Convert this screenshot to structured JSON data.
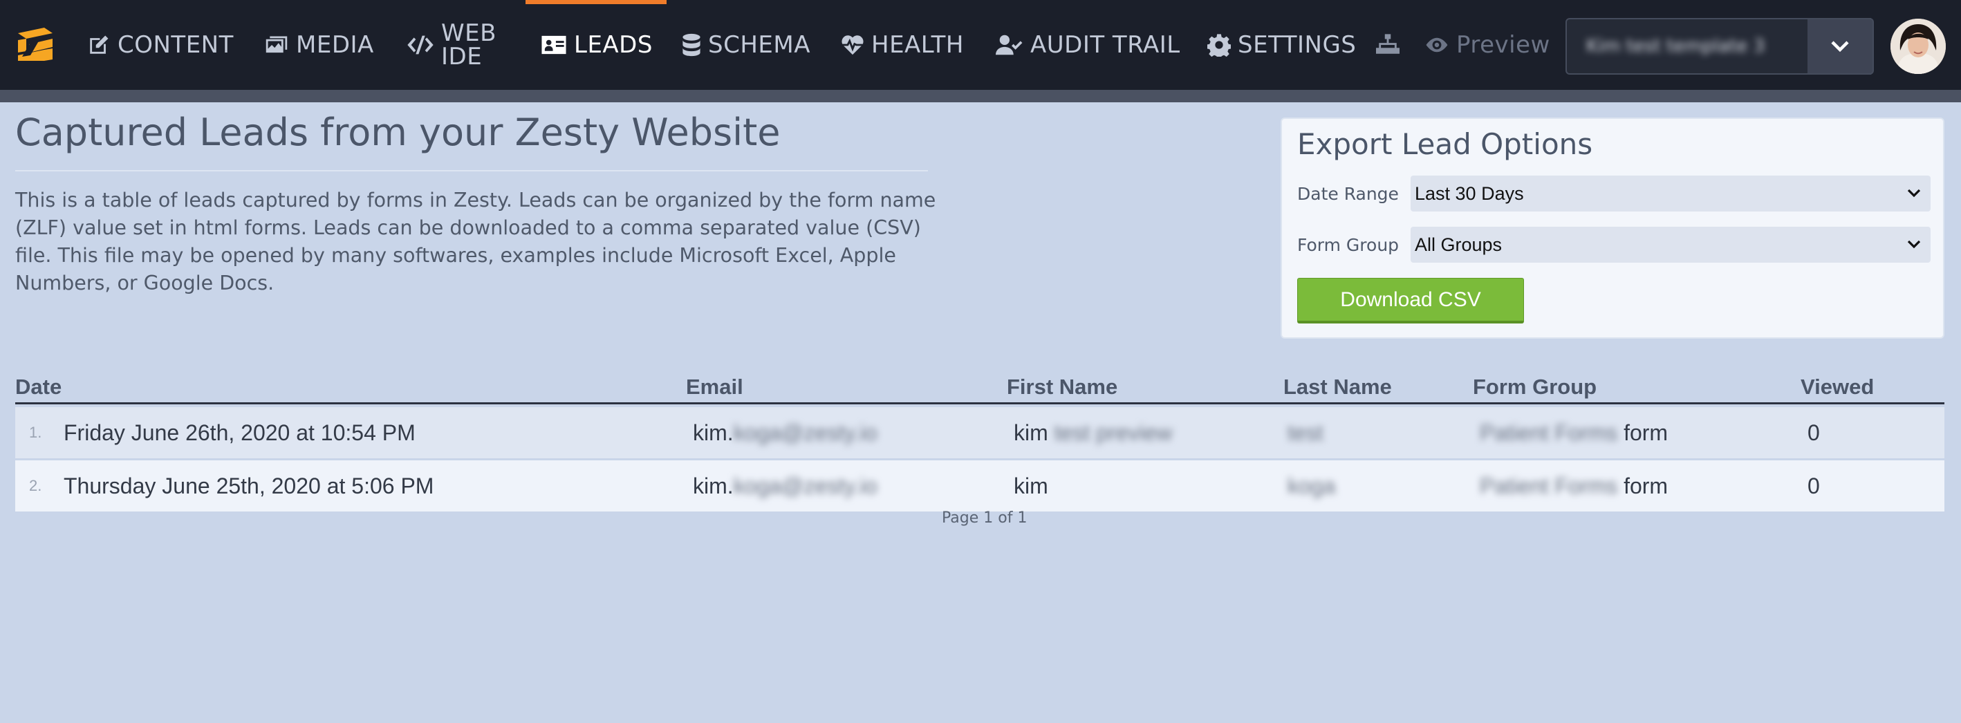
{
  "nav": {
    "items": [
      {
        "label": "CONTENT",
        "icon": "edit-icon"
      },
      {
        "label": "MEDIA",
        "icon": "images-icon"
      },
      {
        "label_line1": "WEB",
        "label_line2": "IDE",
        "icon": "code-icon"
      },
      {
        "label": "LEADS",
        "icon": "address-card-icon",
        "active": true
      },
      {
        "label": "SCHEMA",
        "icon": "database-icon"
      },
      {
        "label": "HEALTH",
        "icon": "heartbeat-icon"
      },
      {
        "label": "AUDIT TRAIL",
        "icon": "user-check-icon"
      },
      {
        "label": "SETTINGS",
        "icon": "gear-icon"
      }
    ],
    "sitemap_icon": "sitemap-icon",
    "preview_label": "Preview",
    "instance_name": "Kim test template 3",
    "accent_color": "#f07c2a"
  },
  "main": {
    "title": "Captured Leads from your Zesty Website",
    "description": "This is a table of leads captured by forms in Zesty. Leads can be organized by the form name (ZLF) value set in html forms. Leads can be downloaded to a comma separated value (CSV) file. This file may be opened by many softwares, examples include Microsoft Excel, Apple Numbers, or Google Docs."
  },
  "export": {
    "title": "Export Lead Options",
    "date_range_label": "Date Range",
    "date_range_value": "Last 30 Days",
    "form_group_label": "Form Group",
    "form_group_value": "All Groups",
    "download_label": "Download CSV",
    "button_color": "#7bbb3a"
  },
  "table": {
    "headers": [
      "Date",
      "Email",
      "First Name",
      "Last Name",
      "Form Group",
      "Viewed"
    ],
    "rows": [
      {
        "num": "1.",
        "date": "Friday June 26th, 2020 at 10:54 PM",
        "email_prefix": "kim.",
        "email_hidden": "koga@zesty.io",
        "first_name": "kim",
        "first_name_hidden": "test preview",
        "last_name_hidden": "test",
        "form_group_hidden": "Patient Forms",
        "form_group_suffix": "form",
        "viewed": "0"
      },
      {
        "num": "2.",
        "date": "Thursday June 25th, 2020 at 5:06 PM",
        "email_prefix": "kim.",
        "email_hidden": "koga@zesty.io",
        "first_name": "kim",
        "first_name_hidden": "",
        "last_name_hidden": "koga",
        "form_group_hidden": "Patient Forms",
        "form_group_suffix": "form",
        "viewed": "0"
      }
    ],
    "page_info": "Page 1 of 1"
  }
}
